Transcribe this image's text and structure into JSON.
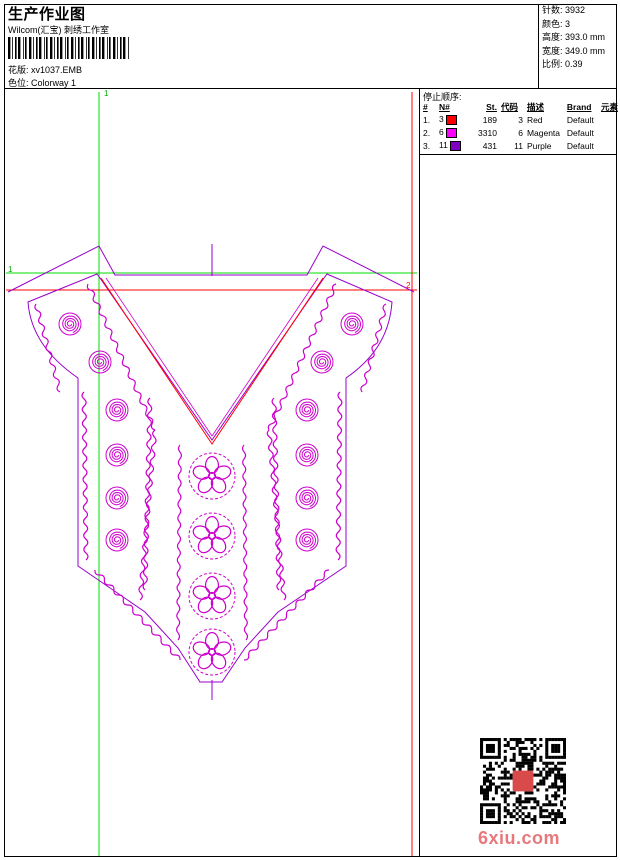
{
  "header": {
    "title": "生产作业图",
    "subtitle": "Wilcom(汇宝) 刺绣工作室",
    "design_label": "花版:",
    "design_value": "xv1037.EMB",
    "colorway_label": "色位:",
    "colorway_value": "Colorway 1"
  },
  "stats": [
    {
      "label": "针数:",
      "value": "3932"
    },
    {
      "label": "颜色:",
      "value": "3"
    },
    {
      "label": "高度:",
      "value": "393.0 mm"
    },
    {
      "label": "宽度:",
      "value": "349.0 mm"
    },
    {
      "label": "比例:",
      "value": "0.39"
    }
  ],
  "stop_sequence": {
    "title": "停止顺序:",
    "columns": [
      "#",
      "N#",
      "St.",
      "代码",
      "描述",
      "Brand",
      "元素"
    ],
    "rows": [
      {
        "num": "1.",
        "n": "3",
        "st": "189",
        "code": "3",
        "desc": "Red",
        "brand": "Default",
        "color": "#ff0000"
      },
      {
        "num": "2.",
        "n": "6",
        "st": "3310",
        "code": "6",
        "desc": "Magenta",
        "brand": "Default",
        "color": "#ff00ff"
      },
      {
        "num": "3.",
        "n": "11",
        "st": "431",
        "code": "11",
        "desc": "Purple",
        "brand": "Default",
        "color": "#8000c0"
      }
    ]
  },
  "guides": {
    "v_label": "1",
    "h_label": "1",
    "red_label": "2"
  },
  "colors": {
    "green": "#00dd00",
    "red": "#ff0000",
    "magenta": "#cc00cc",
    "purple": "#9900cc"
  },
  "watermark": "6xiu.com"
}
